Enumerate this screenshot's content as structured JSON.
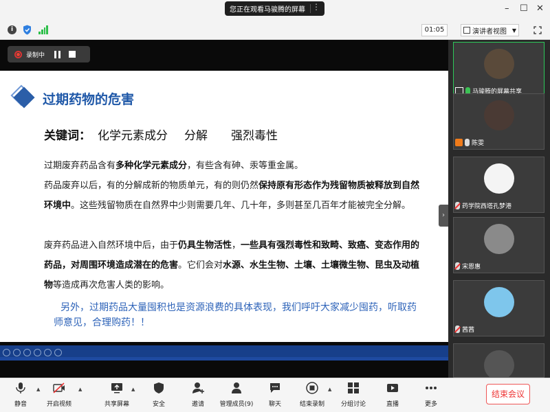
{
  "window": {
    "share_notice": "您正在观看马骏腾的屏幕",
    "more": "⋮",
    "minimize": "–",
    "restore": "☐",
    "close": "✕"
  },
  "infobar": {
    "timer": "01:05",
    "view_mode": "演讲者视图"
  },
  "recording": {
    "label": "录制中"
  },
  "slide": {
    "title": "过期药物的危害",
    "keywords_label": "关键词：",
    "keywords": [
      "化学元素成分",
      "分解",
      "强烈毒性"
    ],
    "p1": {
      "t1": "过期废弃药品含有",
      "b1": "多种化学元素成分",
      "t2": "，有些含有砷、汞等重金属。"
    },
    "p2": {
      "t1": "药品废弃以后，有的分解成新的物质单元，有的则仍然",
      "b1": "保持原有形态作为残留物质被释放到自然环境中",
      "t2": "。这些残留物质在自然界中少则需要几年、几十年，多则甚至几百年才能被完全分解。"
    },
    "p3": {
      "t1": "废弃药品进入自然环境中后，由于",
      "b1": "仍具生物活性",
      "t2": "，",
      "b2": "一些具有强烈毒性和致畸、致癌、变态作用的药品，对周围环境造成潜在的危害",
      "t3": "。它们会对",
      "b3": "水源、水生生物、土壤、土壤微生物、昆虫及动植物",
      "t4": "等造成再次危害人类的影响。"
    },
    "note": "另外，过期药品大量囤积也是资源浪费的具体表现，我们呼吁大家减少囤药，听取药师意见，合理购药！！"
  },
  "participants": [
    {
      "name": "马骏腾的屏幕共享",
      "avatar_color": "#5a4a3a"
    },
    {
      "name": "陈雯",
      "avatar_color": "#4a3a34"
    },
    {
      "name": "药学院西塔孔梦港",
      "avatar_color": "#f4f4f4"
    },
    {
      "name": "宋恩惠",
      "avatar_color": "#8a8a8a"
    },
    {
      "name": "茜茜",
      "avatar_color": "#7ec6ec"
    },
    {
      "name": "",
      "avatar_color": "#555555"
    }
  ],
  "toolbar": {
    "mute": "静音",
    "video": "开启视频",
    "share": "共享屏幕",
    "security": "安全",
    "invite": "邀请",
    "members": "管理成员(9)",
    "chat": "聊天",
    "record": "结束录制",
    "breakout": "分组讨论",
    "live": "直播",
    "more": "更多",
    "end": "结束会议"
  },
  "colors": {
    "title_blue": "#1f58a8",
    "note_blue": "#2c62b8",
    "end_red": "#e33333",
    "active_green": "#2cc95a"
  }
}
